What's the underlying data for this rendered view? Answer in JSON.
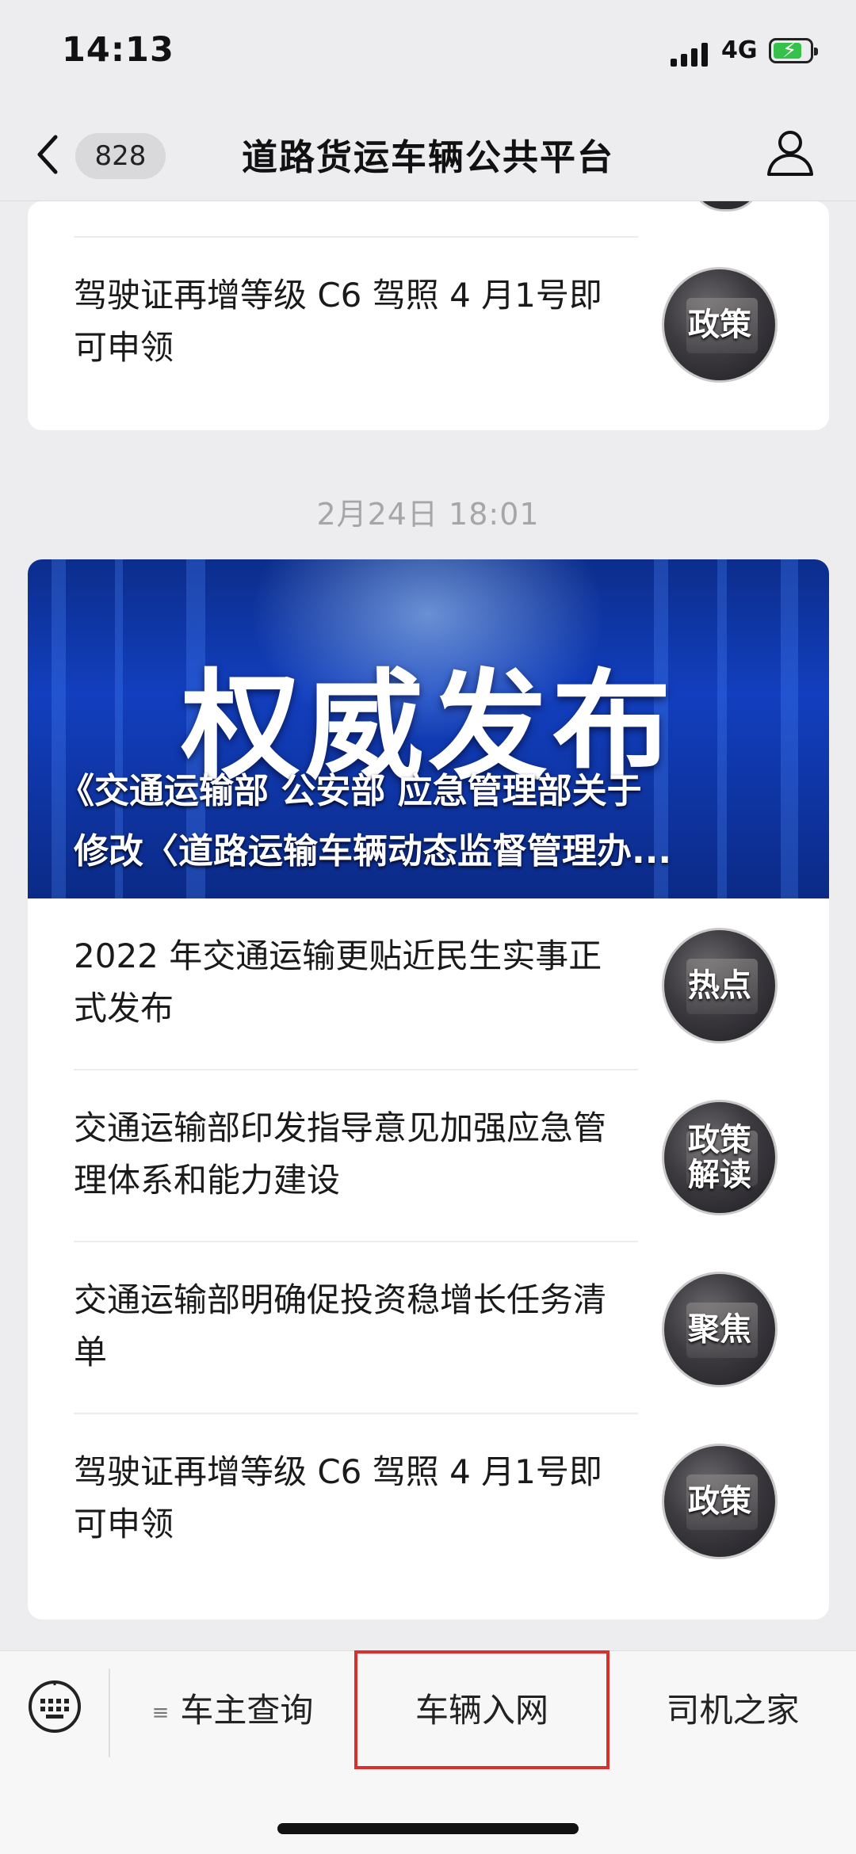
{
  "status_bar": {
    "time": "14:13",
    "network": "4G"
  },
  "nav": {
    "back_count": "828",
    "title": "道路货运车辆公共平台"
  },
  "top_card": {
    "items": [
      {
        "title": "驾驶证再增等级 C6 驾照 4 月1号即可申领",
        "tag": "政策"
      }
    ]
  },
  "timestamp": "2月24日 18:01",
  "main_card": {
    "banner": {
      "headline": "权威发布",
      "subtitle_line1": "《交通运输部 公安部 应急管理部关于",
      "subtitle_line2": "修改〈道路运输车辆动态监督管理办..."
    },
    "items": [
      {
        "title": "2022 年交通运输更贴近民生实事正式发布",
        "tag": "热点"
      },
      {
        "title": "交通运输部印发指导意见加强应急管理体系和能力建设",
        "tag_line1": "政策",
        "tag_line2": "解读"
      },
      {
        "title": "交通运输部明确促投资稳增长任务清单",
        "tag": "聚焦"
      },
      {
        "title": "驾驶证再增等级 C6 驾照 4 月1号即可申领",
        "tag": "政策"
      }
    ]
  },
  "bottom_menu": {
    "owner_query": "车主查询",
    "vehicle_network": "车辆入网",
    "driver_home": "司机之家"
  },
  "colors": {
    "highlight_border": "#d9302d",
    "banner_blue": "#123fbf"
  }
}
